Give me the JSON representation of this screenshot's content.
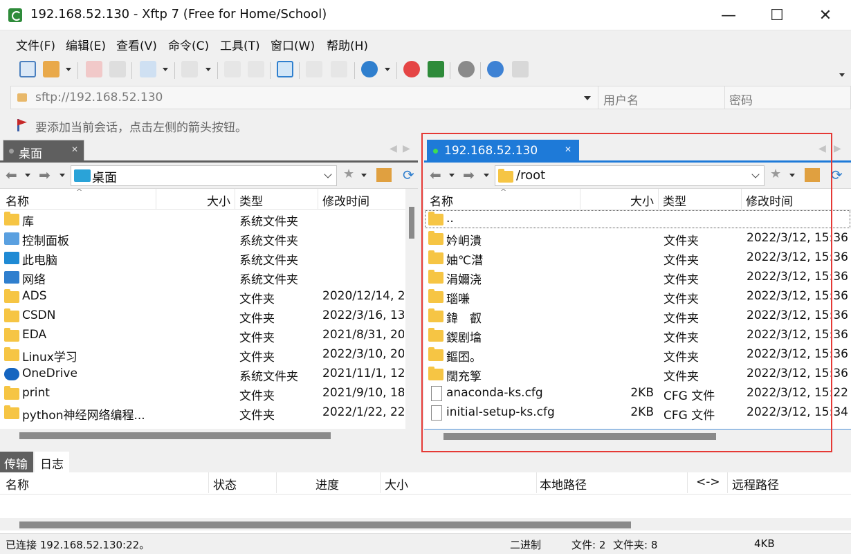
{
  "window": {
    "title": "192.168.52.130 - Xftp 7 (Free for Home/School)"
  },
  "window_controls": {
    "minimize": "—",
    "maximize": "☐",
    "close": "✕"
  },
  "menu": [
    "文件(F)",
    "编辑(E)",
    "查看(V)",
    "命令(C)",
    "工具(T)",
    "窗口(W)",
    "帮助(H)"
  ],
  "address": {
    "url": "sftp://192.168.52.130",
    "username_placeholder": "用户名",
    "password_placeholder": "密码"
  },
  "hint": "要添加当前会话，点击左侧的箭头按钮。",
  "left_pane": {
    "tab_label": "桌面",
    "path": "桌面",
    "columns": [
      "名称",
      "大小",
      "类型",
      "修改时间"
    ],
    "rows": [
      {
        "name": "库",
        "size": "",
        "type": "系统文件夹",
        "modified": "",
        "icon": "folder-icon"
      },
      {
        "name": "控制面板",
        "size": "",
        "type": "系统文件夹",
        "modified": "",
        "icon": "control-panel-icon"
      },
      {
        "name": "此电脑",
        "size": "",
        "type": "系统文件夹",
        "modified": "",
        "icon": "computer-icon"
      },
      {
        "name": "网络",
        "size": "",
        "type": "系统文件夹",
        "modified": "",
        "icon": "network-icon"
      },
      {
        "name": "ADS",
        "size": "",
        "type": "文件夹",
        "modified": "2020/12/14, 2",
        "icon": "folder-icon"
      },
      {
        "name": "CSDN",
        "size": "",
        "type": "文件夹",
        "modified": "2022/3/16, 13",
        "icon": "folder-icon"
      },
      {
        "name": "EDA",
        "size": "",
        "type": "文件夹",
        "modified": "2021/8/31, 20",
        "icon": "folder-icon"
      },
      {
        "name": "Linux学习",
        "size": "",
        "type": "文件夹",
        "modified": "2022/3/10, 20",
        "icon": "folder-icon"
      },
      {
        "name": "OneDrive",
        "size": "",
        "type": "系统文件夹",
        "modified": "2021/11/1, 12",
        "icon": "cloud-icon"
      },
      {
        "name": "print",
        "size": "",
        "type": "文件夹",
        "modified": "2021/9/10, 18",
        "icon": "folder-icon"
      },
      {
        "name": "python神经网络编程...",
        "size": "",
        "type": "文件夹",
        "modified": "2022/1/22, 22",
        "icon": "folder-icon"
      }
    ]
  },
  "right_pane": {
    "tab_label": "192.168.52.130",
    "path": "/root",
    "columns": [
      "名称",
      "大小",
      "类型",
      "修改时间"
    ],
    "rows": [
      {
        "name": "..",
        "size": "",
        "type": "",
        "modified": "",
        "icon": "folder-icon"
      },
      {
        "name": "妗岄潰",
        "size": "",
        "type": "文件夹",
        "modified": "2022/3/12, 15:36",
        "icon": "folder-icon"
      },
      {
        "name": "妯℃澘",
        "size": "",
        "type": "文件夹",
        "modified": "2022/3/12, 15:36",
        "icon": "folder-icon"
      },
      {
        "name": "涓嬭浇",
        "size": "",
        "type": "文件夹",
        "modified": "2022/3/12, 15:36",
        "icon": "folder-icon"
      },
      {
        "name": "瑙嗛",
        "size": "",
        "type": "文件夹",
        "modified": "2022/3/12, 15:36",
        "icon": "folder-icon"
      },
      {
        "name": "鍏　叡",
        "size": "",
        "type": "文件夹",
        "modified": "2022/3/12, 15:36",
        "icon": "folder-icon"
      },
      {
        "name": "鍥剧墖",
        "size": "",
        "type": "文件夹",
        "modified": "2022/3/12, 15:36",
        "icon": "folder-icon"
      },
      {
        "name": "鏂囨。",
        "size": "",
        "type": "文件夹",
        "modified": "2022/3/12, 15:36",
        "icon": "folder-icon"
      },
      {
        "name": "闊充箰",
        "size": "",
        "type": "文件夹",
        "modified": "2022/3/12, 15:36",
        "icon": "folder-icon"
      },
      {
        "name": "anaconda-ks.cfg",
        "size": "2KB",
        "type": "CFG 文件",
        "modified": "2022/3/12, 15:22",
        "icon": "file-icon"
      },
      {
        "name": "initial-setup-ks.cfg",
        "size": "2KB",
        "type": "CFG 文件",
        "modified": "2022/3/12, 15:34",
        "icon": "file-icon"
      }
    ]
  },
  "transfer": {
    "tabs": [
      "传输",
      "日志"
    ],
    "columns": [
      "名称",
      "状态",
      "进度",
      "大小",
      "本地路径",
      "<->",
      "远程路径"
    ]
  },
  "status": {
    "connection": "已连接 192.168.52.130:22。",
    "mode": "二进制",
    "files": "文件: 2",
    "folders": "文件夹: 8",
    "size": "4KB"
  },
  "colors": {
    "accent": "#1e7ad8",
    "highlight_box": "#e53935",
    "folder": "#f6c544"
  }
}
